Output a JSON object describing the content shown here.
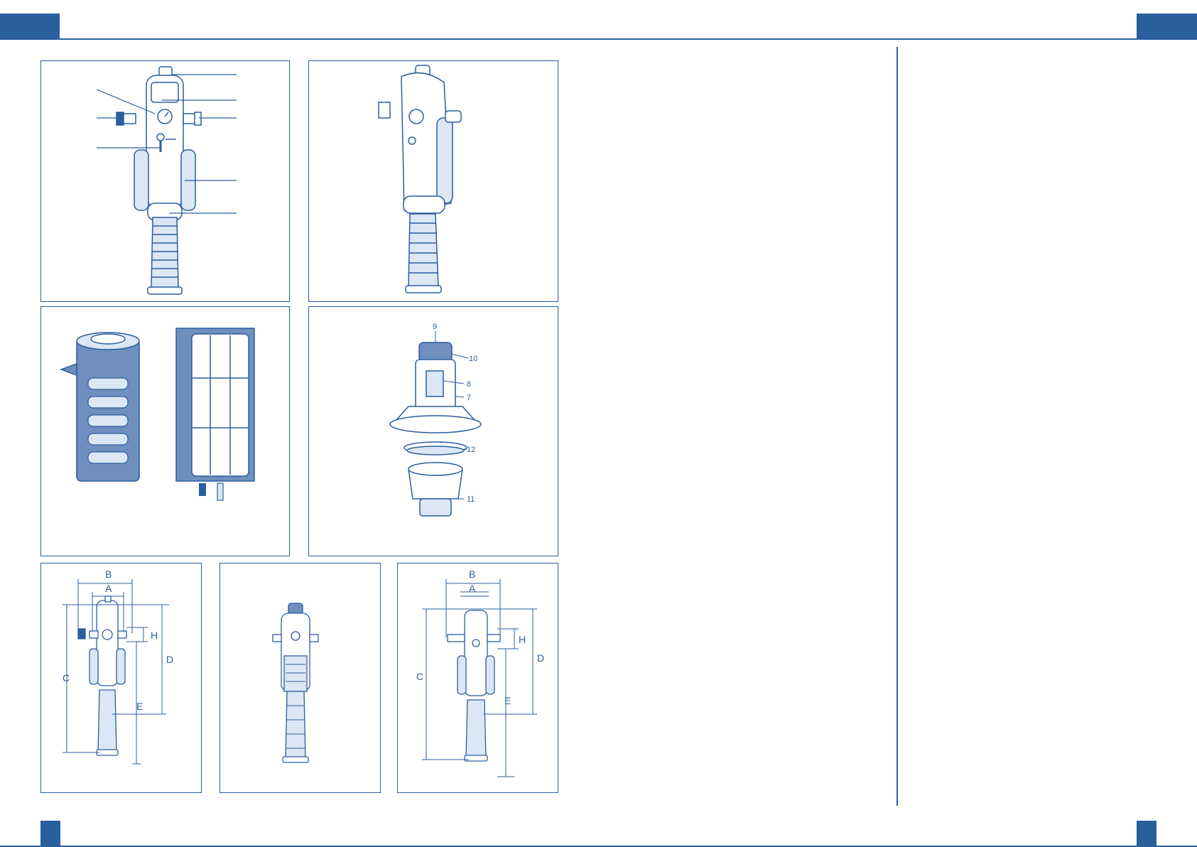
{
  "colors": {
    "accent": "#2a5f9e",
    "light": "#dbe7f4",
    "background": "#ffffff"
  },
  "exploded_view": {
    "callouts": [
      "9",
      "10",
      "8",
      "7",
      "12",
      "11"
    ]
  },
  "dimension_drawing_left": {
    "labels": {
      "b": "B",
      "a": "A",
      "h": "H",
      "d": "D",
      "c": "C",
      "e": "E"
    }
  },
  "dimension_drawing_right": {
    "labels": {
      "b": "B",
      "a": "A",
      "h": "H",
      "d": "D",
      "c": "C",
      "e": "E"
    }
  }
}
